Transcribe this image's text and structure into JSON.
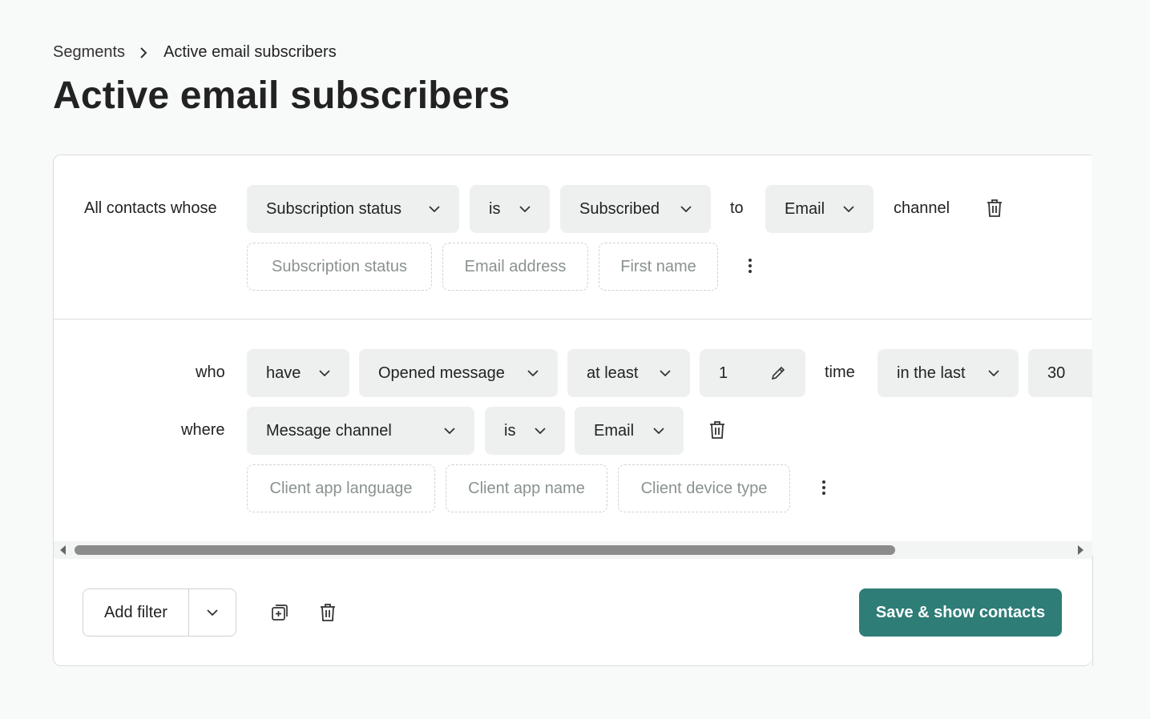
{
  "breadcrumb": {
    "parent": "Segments",
    "current": "Active email subscribers"
  },
  "title": "Active email subscribers",
  "condition1": {
    "label": "All contacts whose",
    "attribute": "Subscription status",
    "operator": "is",
    "value": "Subscribed",
    "to_text": "to",
    "channel": "Email",
    "channel_text": "channel",
    "suggestions": [
      "Subscription status",
      "Email address",
      "First name"
    ]
  },
  "condition2": {
    "who_label": "who",
    "have": "have",
    "event": "Opened message",
    "frequency": "at least",
    "count": "1",
    "time_text": "time",
    "period": "in the last",
    "period_value": "30",
    "where_label": "where",
    "where_attribute": "Message channel",
    "where_operator": "is",
    "where_value": "Email",
    "suggestions": [
      "Client app language",
      "Client app name",
      "Client device type"
    ]
  },
  "footer": {
    "add_filter": "Add filter",
    "save": "Save & show contacts"
  },
  "colors": {
    "primary": "#2e7d77",
    "pill_bg": "#eef0f0"
  }
}
